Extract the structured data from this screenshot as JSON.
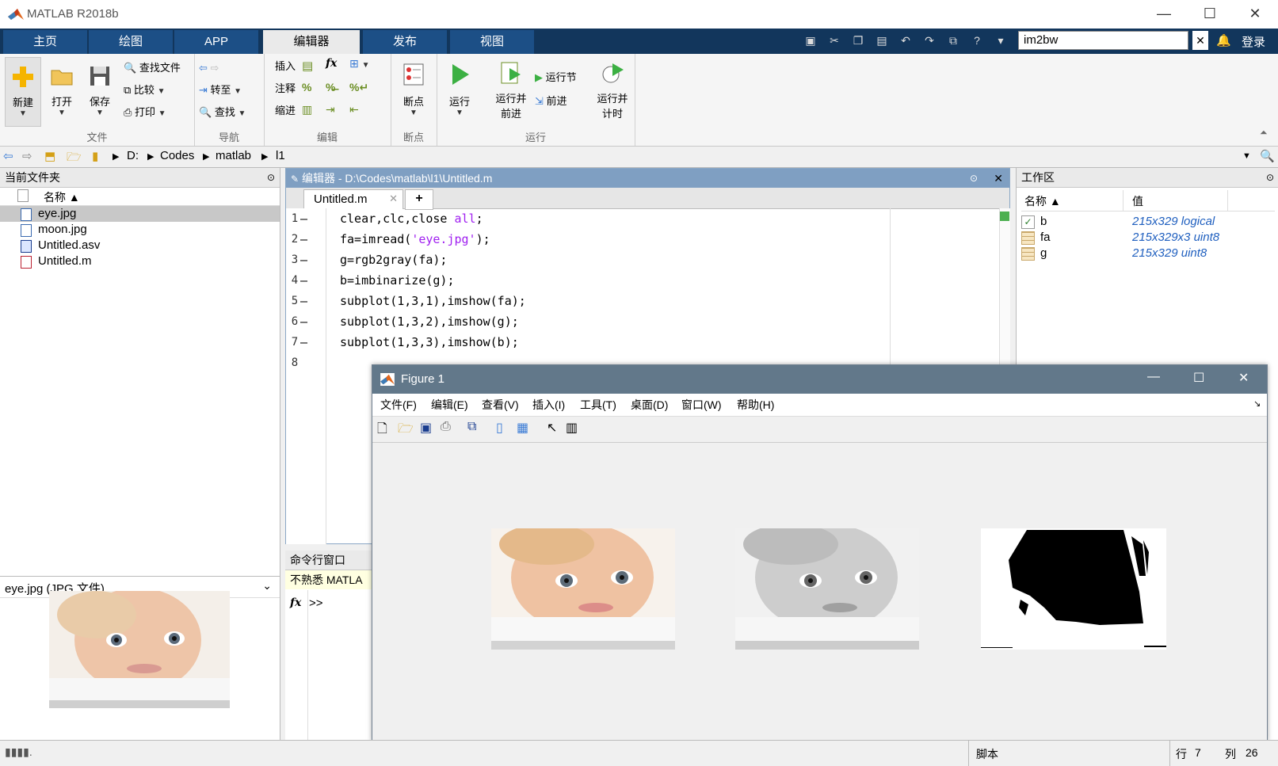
{
  "window": {
    "title": "MATLAB R2018b",
    "minimize": "—",
    "maximize": "☐",
    "close": "✕"
  },
  "ribbon_tabs": [
    {
      "label": "主页"
    },
    {
      "label": "绘图"
    },
    {
      "label": "APP"
    },
    {
      "label": "编辑器"
    },
    {
      "label": "发布"
    },
    {
      "label": "视图"
    }
  ],
  "search": {
    "value": "im2bw",
    "clear": "✕"
  },
  "login": "登录",
  "ribbon": {
    "file": {
      "label": "文件",
      "new": "新建",
      "open": "打开",
      "save": "保存",
      "find_files": "查找文件",
      "compare": "比较",
      "print": "打印"
    },
    "nav": {
      "label": "导航",
      "goto": "转至",
      "find": "查找"
    },
    "edit": {
      "label": "编辑",
      "insert": "插入",
      "comment": "注释",
      "indent": "缩进",
      "fx": "fx"
    },
    "breakpoints": {
      "label": "断点",
      "breakpoints": "断点"
    },
    "run": {
      "label": "运行",
      "run": "运行",
      "run_advance_1": "运行并",
      "run_advance_2": "前进",
      "run_section": "运行节",
      "advance": "前进",
      "run_time_1": "运行并",
      "run_time_2": "计时"
    }
  },
  "address": {
    "drive": "D:",
    "p1": "Codes",
    "p2": "matlab",
    "p3": "l1"
  },
  "current_folder": {
    "title": "当前文件夹",
    "col_name": "名称 ▲",
    "files": [
      {
        "name": "eye.jpg",
        "selected": true
      },
      {
        "name": "moon.jpg",
        "selected": false
      },
      {
        "name": "Untitled.asv",
        "selected": false
      },
      {
        "name": "Untitled.m",
        "selected": false
      }
    ],
    "details_title": "eye.jpg  (JPG 文件)"
  },
  "editor": {
    "title": "编辑器 - D:\\Codes\\matlab\\l1\\Untitled.m",
    "tab": "Untitled.m",
    "add_tab": "+",
    "lines": [
      {
        "n": "1",
        "dash": "—",
        "code": "clear,clc,close ",
        "kw": "all",
        "tail": ";"
      },
      {
        "n": "2",
        "dash": "—",
        "code": "fa=imread(",
        "str": "'eye.jpg'",
        "tail": ");"
      },
      {
        "n": "3",
        "dash": "—",
        "code": "g=rgb2gray(fa);",
        "kw": "",
        "tail": ""
      },
      {
        "n": "4",
        "dash": "—",
        "code": "b=imbinarize(g);",
        "kw": "",
        "tail": ""
      },
      {
        "n": "5",
        "dash": "—",
        "code": "subplot(1,3,1),imshow(fa);",
        "kw": "",
        "tail": ""
      },
      {
        "n": "6",
        "dash": "—",
        "code": "subplot(1,3,2),imshow(g);",
        "kw": "",
        "tail": ""
      },
      {
        "n": "7",
        "dash": "—",
        "code": "subplot(1,3,3),imshow(b);",
        "kw": "",
        "tail": ""
      },
      {
        "n": "8",
        "dash": "",
        "code": "",
        "kw": "",
        "tail": ""
      }
    ]
  },
  "command_window": {
    "title": "命令行窗口",
    "notice": "不熟悉 MATLA",
    "fx": "fx",
    "prompt": ">>"
  },
  "workspace": {
    "title": "工作区",
    "col_name": "名称 ▲",
    "col_value": "值",
    "vars": [
      {
        "name": "b",
        "value": "215x329 logical"
      },
      {
        "name": "fa",
        "value": "215x329x3 uint8"
      },
      {
        "name": "g",
        "value": "215x329 uint8"
      }
    ]
  },
  "figure": {
    "title": "Figure 1",
    "menus": [
      "文件(F)",
      "编辑(E)",
      "查看(V)",
      "插入(I)",
      "工具(T)",
      "桌面(D)",
      "窗口(W)",
      "帮助(H)"
    ]
  },
  "status": {
    "mode": "脚本",
    "row_label": "行",
    "row": "7",
    "col_label": "列",
    "col": "26"
  }
}
